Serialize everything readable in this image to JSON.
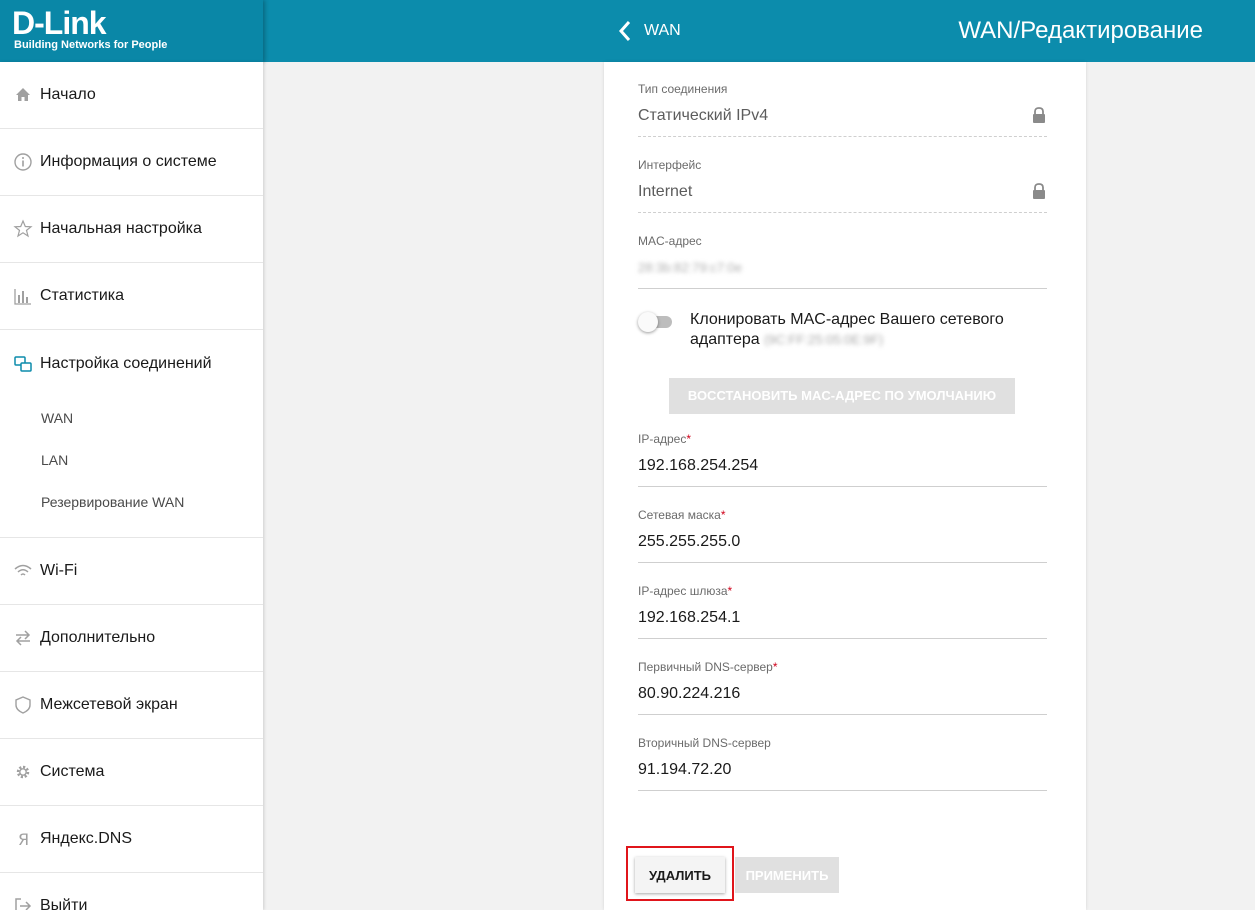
{
  "header": {
    "logo_main": "D-Link",
    "logo_sub": "Building Networks for People",
    "back_label": "WAN",
    "title": "WAN/Редактирование"
  },
  "sidebar": {
    "items": [
      {
        "label": "Начало",
        "icon": "home-icon"
      },
      {
        "label": "Информация о системе",
        "icon": "info-icon"
      },
      {
        "label": "Начальная настройка",
        "icon": "star-icon"
      },
      {
        "label": "Статистика",
        "icon": "bar-chart-icon"
      },
      {
        "label": "Настройка соединений",
        "icon": "connections-icon"
      },
      {
        "label": "Wi-Fi",
        "icon": "wifi-icon"
      },
      {
        "label": "Дополнительно",
        "icon": "arrows-icon"
      },
      {
        "label": "Межсетевой экран",
        "icon": "shield-icon"
      },
      {
        "label": "Система",
        "icon": "gear-icon"
      },
      {
        "label": "Яндекс.DNS",
        "icon": "yandex-icon"
      },
      {
        "label": "Выйти",
        "icon": "logout-icon"
      }
    ],
    "sub_items": [
      "WAN",
      "LAN",
      "Резервирование WAN"
    ]
  },
  "form": {
    "connection_type": {
      "label": "Тип соединения",
      "value": "Статический IPv4"
    },
    "interface": {
      "label": "Интерфейс",
      "value": "Internet"
    },
    "mac": {
      "label": "MAC-адрес",
      "value": "28:3b:82:79:c7:0e"
    },
    "clone_mac": {
      "label": "Клонировать MAC-адрес Вашего сетевого адаптера",
      "hidden_value": "(9C:FF:25:05:0E:9F)",
      "enabled": false
    },
    "restore_button": "ВОССТАНОВИТЬ MAC-АДРЕС ПО УМОЛЧАНИЮ",
    "ip": {
      "label": "IP-адрес",
      "required": "*",
      "value": "192.168.254.254"
    },
    "mask": {
      "label": "Сетевая маска",
      "required": "*",
      "value": "255.255.255.0"
    },
    "gateway": {
      "label": "IP-адрес шлюза",
      "required": "*",
      "value": "192.168.254.1"
    },
    "dns1": {
      "label": "Первичный DNS-сервер",
      "required": "*",
      "value": "80.90.224.216"
    },
    "dns2": {
      "label": "Вторичный DNS-сервер",
      "value": "91.194.72.20"
    },
    "delete_button": "УДАЛИТЬ",
    "apply_button": "ПРИМЕНИТЬ"
  },
  "colors": {
    "header": "#0c8cac",
    "highlight": "#e0151b",
    "required": "#d0021b"
  }
}
